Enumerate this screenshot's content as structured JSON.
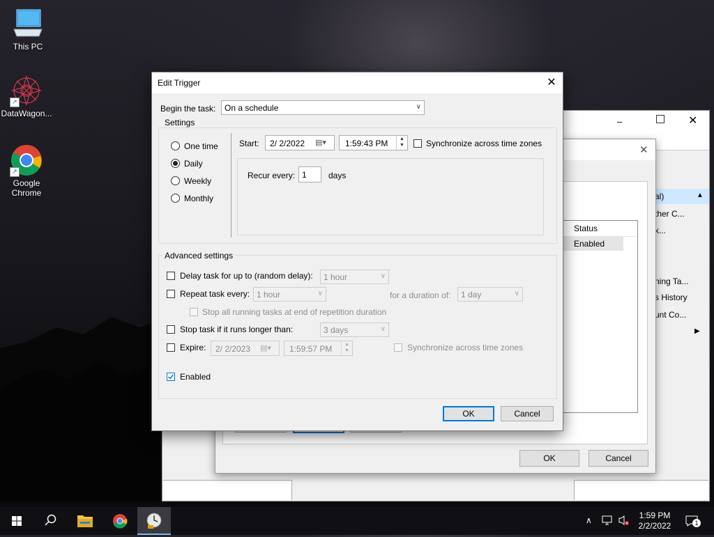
{
  "desktop": {
    "icons": [
      {
        "label": "This PC"
      },
      {
        "label": "DataWagon..."
      },
      {
        "label": "Google Chrome"
      }
    ]
  },
  "background_windows": {
    "list": {
      "header_status": "Status",
      "row_status": "Enabled"
    },
    "actions": {
      "item1": "al)",
      "item2": "ther C...",
      "item3": "k...",
      "item4": "ning Ta...",
      "item5": "s History",
      "item6": "unt Co..."
    },
    "ok_label": "OK",
    "cancel_label": "Cancel"
  },
  "dialog": {
    "title": "Edit Trigger",
    "begin_label": "Begin the task:",
    "begin_value": "On a schedule",
    "settings_label": "Settings",
    "schedule_options": [
      "One time",
      "Daily",
      "Weekly",
      "Monthly"
    ],
    "selected_option": "Daily",
    "start_label": "Start:",
    "start_date": "2/  2/2022",
    "start_time": "1:59:43 PM",
    "sync_label": "Synchronize across time zones",
    "recur_label": "Recur every:",
    "recur_value": "1",
    "recur_unit": "days",
    "advanced_label": "Advanced settings",
    "delay_label": "Delay task for up to (random delay):",
    "delay_value": "1 hour",
    "repeat_label": "Repeat task every:",
    "repeat_value": "1 hour",
    "duration_label": "for a duration of:",
    "duration_value": "1 day",
    "stop_running_label": "Stop all running tasks at end of repetition duration",
    "stop_longer_label": "Stop task if it runs longer than:",
    "stop_longer_value": "3 days",
    "expire_label": "Expire:",
    "expire_date": "2/  2/2023",
    "expire_time": "1:59:57 PM",
    "expire_sync_label": "Synchronize across time zones",
    "enabled_label": "Enabled",
    "ok_label": "OK",
    "cancel_label": "Cancel"
  },
  "taskbar": {
    "time": "1:59 PM",
    "date": "2/2/2022",
    "notification_count": "1"
  },
  "colors": {
    "accent": "#0078d7",
    "dialog_bg": "#f0f0f0"
  }
}
